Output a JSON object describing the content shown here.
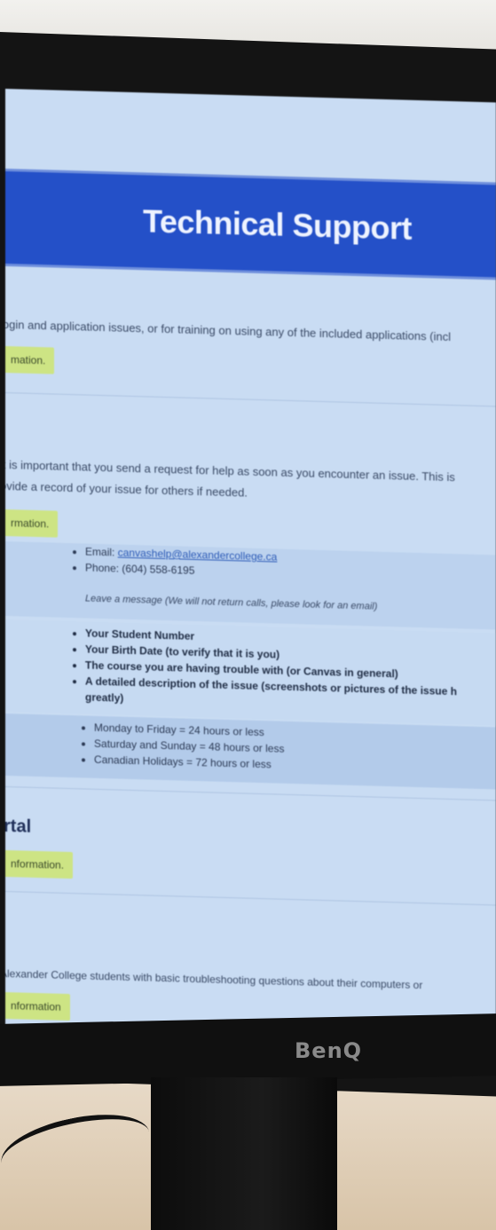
{
  "banner": {
    "title": "Technical Support"
  },
  "section1": {
    "text": "login and application issues, or for training on using any of the included applications (incl",
    "button": "mation."
  },
  "section2": {
    "text_line1": "it is important that you send a request for help as soon as you encounter an issue. This is",
    "text_line2": "ovide a record of your issue for others if needed.",
    "button": "rmation.",
    "contact": {
      "email_label": "Email:",
      "email": "canvashelp@alexandercollege.ca",
      "phone": "Phone: (604) 558-6195",
      "note": "Leave a message (We will not return calls, please look for an email)"
    },
    "requirements": [
      "Your Student Number",
      "Your Birth Date (to verify that it is you)",
      "The course you are having trouble with (or Canvas in general)",
      "A detailed description of the issue (screenshots or pictures of the issue h",
      "greatly)"
    ],
    "response_times": [
      "Monday to Friday = 24 hours or less",
      "Saturday and Sunday = 48 hours or less",
      "Canadian Holidays = 72 hours or less"
    ]
  },
  "section3": {
    "heading": "rtal",
    "button": "nformation."
  },
  "section4": {
    "text": "Alexander College students with basic troubleshooting questions about their computers or",
    "button": "nformation"
  },
  "monitor": {
    "brand": "BenQ"
  }
}
